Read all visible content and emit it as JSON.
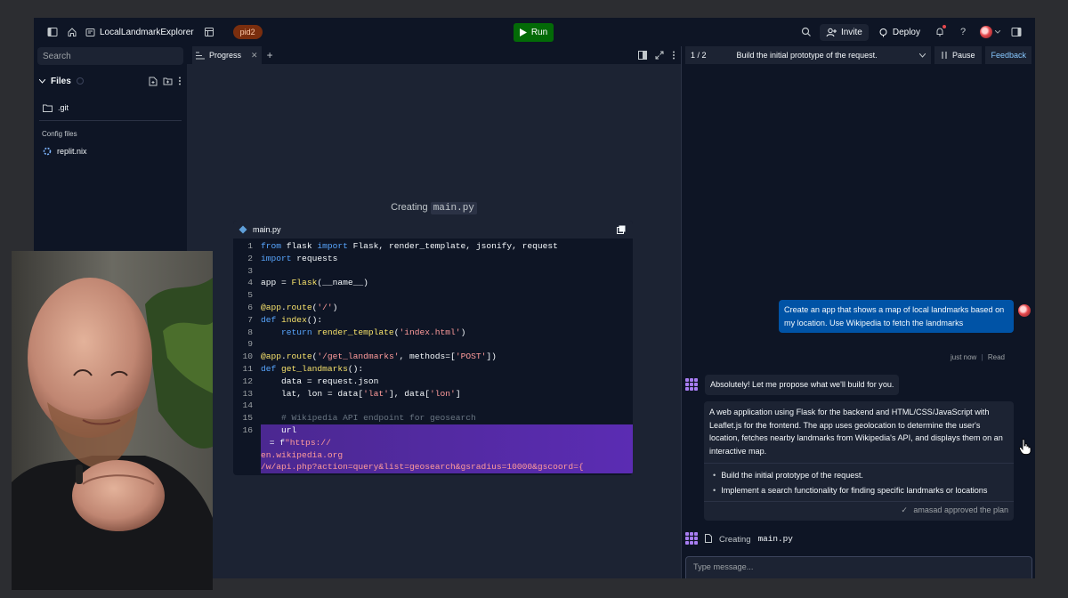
{
  "topbar": {
    "repl_name": "LocalLandmarkExplorer",
    "pill": "pid2",
    "run_label": "Run",
    "invite_label": "Invite",
    "deploy_label": "Deploy"
  },
  "sidebar": {
    "search_placeholder": "Search",
    "files_label": "Files",
    "items": [
      ".git"
    ],
    "config_section": "Config files",
    "config_items": [
      "replit.nix"
    ]
  },
  "editor": {
    "tab_label": "Progress",
    "creating_prefix": "Creating",
    "creating_file": "main.py",
    "card_file": "main.py",
    "lines": [
      {
        "n": "1"
      },
      {
        "n": "2"
      },
      {
        "n": "3"
      },
      {
        "n": "4"
      },
      {
        "n": "5"
      },
      {
        "n": "6"
      },
      {
        "n": "7"
      },
      {
        "n": "8"
      },
      {
        "n": "9"
      },
      {
        "n": "10"
      },
      {
        "n": "11"
      },
      {
        "n": "12"
      },
      {
        "n": "13"
      },
      {
        "n": "14"
      },
      {
        "n": "15"
      },
      {
        "n": "16"
      }
    ]
  },
  "chat": {
    "step_counter": "1 / 2",
    "step_title": "Build the initial prototype of the request.",
    "pause_label": "Pause",
    "feedback_label": "Feedback",
    "user_message": "Create an app that shows a map of local landmarks based on my location. Use Wikipedia to fetch the landmarks",
    "user_meta_time": "just now",
    "user_meta_read": "Read",
    "agent_intro": "Absolutely! Let me propose what we'll build for you.",
    "plan_description": "A web application using Flask for the backend and HTML/CSS/JavaScript with Leaflet.js for the frontend. The app uses geolocation to determine the user's location, fetches nearby landmarks from Wikipedia's API, and displays them on an interactive map.",
    "plan_items": [
      "Build the initial prototype of the request.",
      "Implement a search functionality for finding specific landmarks or locations"
    ],
    "approved": "amasad approved the plan",
    "creating_prefix": "Creating",
    "creating_file": "main.py",
    "input_placeholder": "Type message..."
  },
  "colors": {
    "background": "#0e1525",
    "panel": "#1c2333",
    "run": "#036a07",
    "user_bubble": "#0053a6",
    "agent_accent": "#a87df2"
  }
}
